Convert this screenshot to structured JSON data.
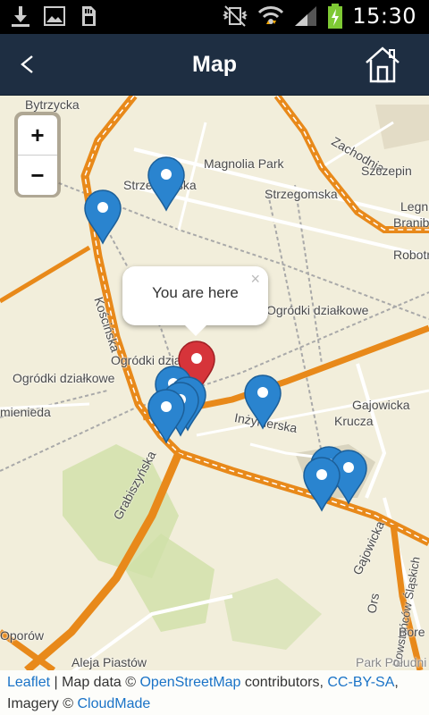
{
  "status_bar": {
    "time": "15:30",
    "left_icons": [
      "download-icon",
      "image-icon",
      "sd-card-icon"
    ],
    "right_icons": [
      "vibrate-mute-icon",
      "wifi-icon",
      "signal-icon",
      "battery-charging-icon"
    ]
  },
  "app_bar": {
    "back_label": "<",
    "title": "Map",
    "home_icon": "home-icon"
  },
  "map": {
    "zoom_in_label": "+",
    "zoom_out_label": "−",
    "popup": {
      "text": "You are here",
      "close": "×"
    },
    "labels": [
      "Bytrzycka",
      "Zachodnia",
      "Magnolia Park",
      "Szczepin",
      "Strzegomska",
      "Strzegomska",
      "Legni",
      "Branibo",
      "Robotn",
      "Kościńska",
      "Ogródki działkowe",
      "Ogródki działkowe",
      "Ogródki działkowe",
      "mienieda",
      "Inżynierska",
      "Gajowicka",
      "Krucza",
      "Grabiszyńska",
      "Gajowicka",
      "Ors",
      "Powstańców Śląskich",
      "Bore",
      "Oporów",
      "Aleja Piastów",
      "Park Południ"
    ],
    "markers_colors": {
      "blue": "#2a84cf",
      "red": "#d6343a"
    }
  },
  "attribution": {
    "leaflet": "Leaflet",
    "sep1": " | Map data © ",
    "osm": "OpenStreetMap",
    "sep2": " contributors, ",
    "license": "CC-BY-SA",
    "sep3": ",",
    "imagery": "Imagery © ",
    "cloudmade": "CloudMade"
  }
}
